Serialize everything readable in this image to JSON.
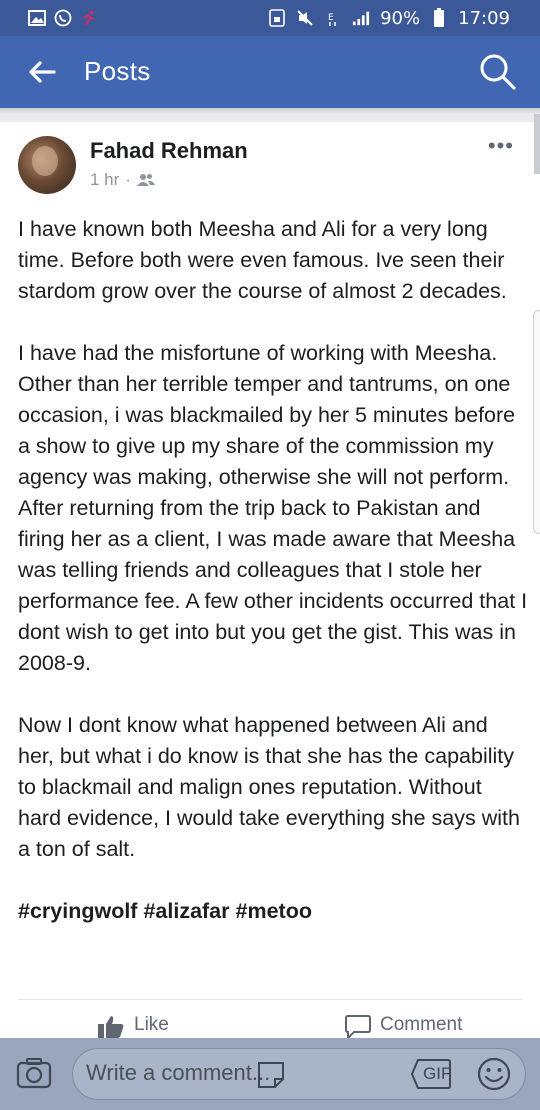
{
  "status_bar": {
    "battery": "90%",
    "time": "17:09"
  },
  "app_bar": {
    "title": "Posts"
  },
  "post": {
    "author": "Fahad Rehman",
    "time": "1 hr",
    "separator": "·",
    "paragraphs": [
      "I have known both Meesha and Ali for a very long time. Before both were even famous. Ive seen their stardom grow over the course of almost 2 decades.",
      "I have had the misfortune of working with Meesha. Other than her terrible temper and tantrums, on one occasion, i was blackmailed by her 5 minutes before a show to give up my share of the commission my agency was making, otherwise she will not perform. After returning from the trip back to Pakistan and firing her as a client, I was made aware that Meesha was telling friends and colleagues that I stole her performance fee. A few other incidents occurred that I dont wish to get into but you get the gist. This was in 2008-9.",
      "Now I dont know what happened between Ali and her, but what i do know is that she has the capability to blackmail and malign ones reputation. Without hard evidence, I would take everything she says with a ton of salt."
    ],
    "hashtags": [
      "#cryingwolf",
      "#alizafar",
      "#metoo"
    ],
    "actions": {
      "like": "Like",
      "comment": "Comment"
    }
  },
  "composer": {
    "placeholder": "Write a comment...",
    "gif_label": "GIF"
  },
  "colors": {
    "header": "#4267b2",
    "status_bar": "#3b5998",
    "text": "#1c1e21",
    "meta": "#90949c"
  }
}
